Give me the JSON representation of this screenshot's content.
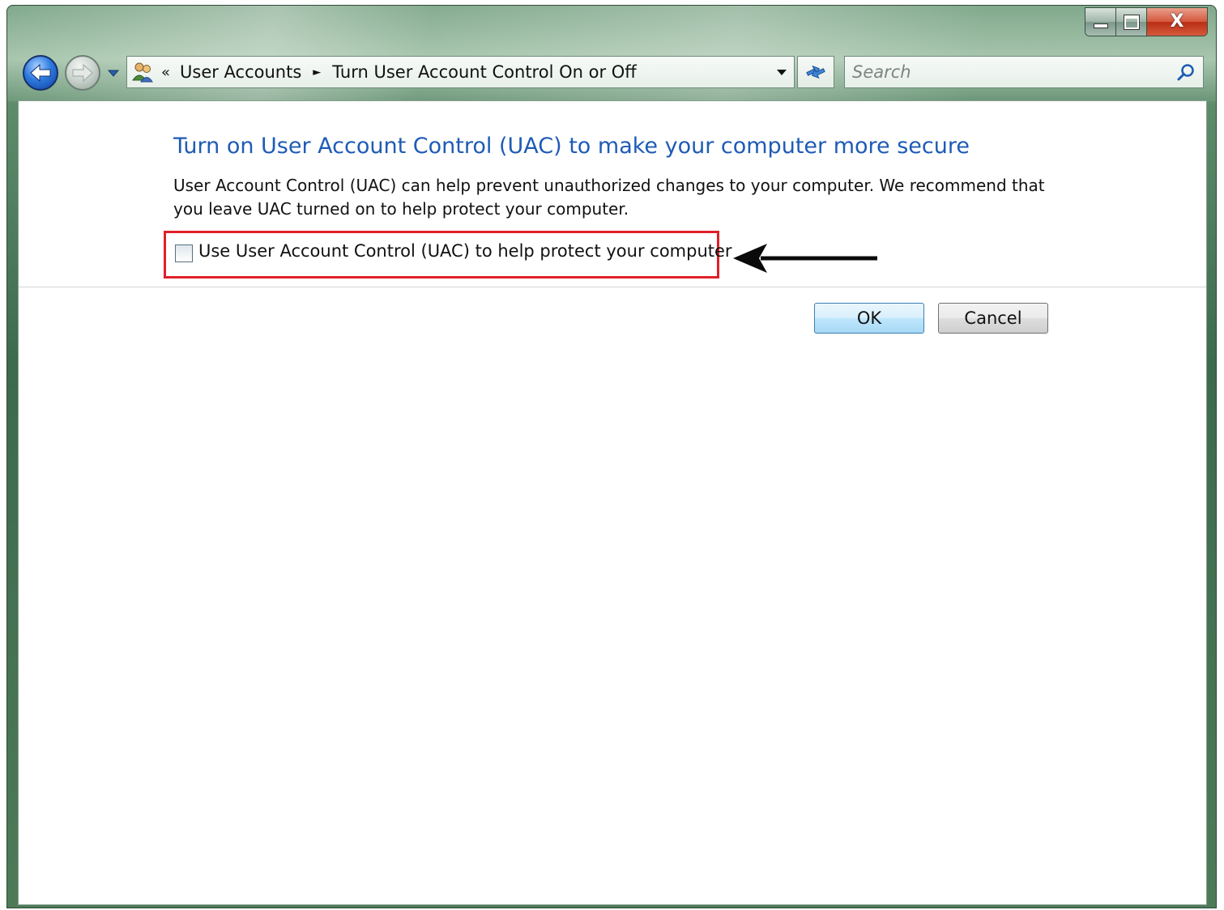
{
  "window": {
    "caption_buttons": {
      "minimize_icon": "minimize-icon",
      "maximize_icon": "maximize-icon",
      "close_glyph": "X"
    }
  },
  "navigation": {
    "back_icon": "back-arrow-icon",
    "forward_icon": "forward-arrow-icon",
    "history_icon": "chevron-down-icon"
  },
  "address_bar": {
    "overflow_glyph": "«",
    "breadcrumbs": [
      "User Accounts",
      "Turn User Account Control On or Off"
    ],
    "separator_glyph": "►"
  },
  "search": {
    "placeholder": "Search"
  },
  "page": {
    "heading": "Turn on User Account Control (UAC) to make your computer more secure",
    "description": "User Account Control (UAC) can help prevent unauthorized changes to your computer.  We recommend that you leave UAC turned on to help protect your computer.",
    "checkbox_label": "Use User Account Control (UAC) to help protect your computer",
    "checkbox_checked": false
  },
  "buttons": {
    "ok": "OK",
    "cancel": "Cancel"
  },
  "colors": {
    "heading": "#1e5bb6",
    "highlight_box": "#e0202a"
  }
}
